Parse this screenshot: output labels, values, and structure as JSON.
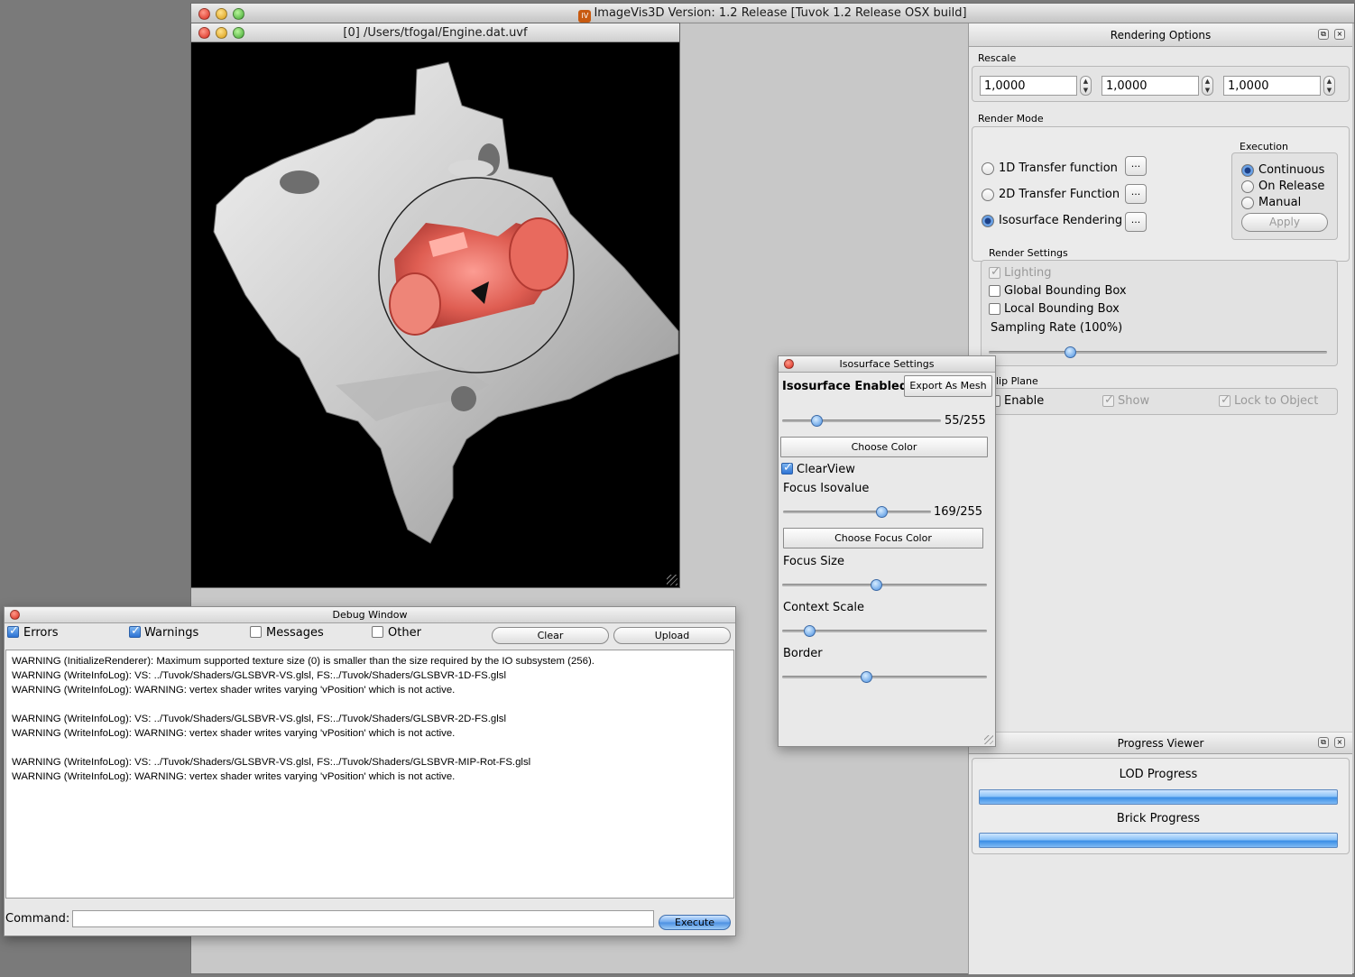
{
  "app": {
    "title": "ImageVis3D Version: 1.2 Release [Tuvok 1.2 Release OSX build]"
  },
  "render_window": {
    "title": "[0] /Users/tfogal/Engine.dat.uvf"
  },
  "rendering_options": {
    "title": "Rendering Options",
    "rescale": {
      "label": "Rescale",
      "values": [
        "1,0000",
        "1,0000",
        "1,0000"
      ]
    },
    "render_mode": {
      "label": "Render Mode",
      "options": [
        "1D Transfer function",
        "2D Transfer Function",
        "Isosurface Rendering"
      ],
      "selected": "Isosurface Rendering",
      "more_button": "..."
    },
    "execution": {
      "label": "Execution",
      "options": [
        "Continuous",
        "On Release",
        "Manual"
      ],
      "selected": "Continuous",
      "apply_label": "Apply"
    },
    "render_settings": {
      "label": "Render Settings",
      "lighting": "Lighting",
      "global_bbox": "Global Bounding Box",
      "local_bbox": "Local Bounding Box",
      "sampling_rate": "Sampling Rate (100%)",
      "sampling_value": 0.24
    },
    "clip_plane": {
      "label": "lip Plane",
      "enable": "Enable",
      "show": "Show",
      "lock": "Lock to Object"
    }
  },
  "isosurface": {
    "title": "Isosurface Settings",
    "enabled_label": "Isosurface Enabled",
    "export_label": "Export As Mesh",
    "iso_readout": "55/255",
    "iso_value": 0.216,
    "choose_color": "Choose Color",
    "clearview": "ClearView",
    "focus_isovalue_label": "Focus Isovalue",
    "focus_readout": "169/255",
    "focus_value": 0.663,
    "choose_focus_color": "Choose Focus Color",
    "focus_size_label": "Focus Size",
    "focus_size_value": 0.46,
    "context_scale_label": "Context Scale",
    "context_scale_value": 0.13,
    "border_label": "Border",
    "border_value": 0.41
  },
  "progress": {
    "title": "Progress Viewer",
    "lod_label": "LOD Progress",
    "brick_label": "Brick Progress"
  },
  "debug": {
    "title": "Debug Window",
    "filters": {
      "errors": "Errors",
      "warnings": "Warnings",
      "messages": "Messages",
      "other": "Other"
    },
    "clear_label": "Clear",
    "upload_label": "Upload",
    "log": [
      "WARNING (InitializeRenderer): Maximum supported texture size (0) is smaller than the size required by the IO subsystem (256).",
      "WARNING (WriteInfoLog): VS: ../Tuvok/Shaders/GLSBVR-VS.glsl, FS:../Tuvok/Shaders/GLSBVR-1D-FS.glsl",
      "WARNING (WriteInfoLog): WARNING: vertex shader writes varying 'vPosition' which is not active.",
      "",
      "WARNING (WriteInfoLog): VS: ../Tuvok/Shaders/GLSBVR-VS.glsl, FS:../Tuvok/Shaders/GLSBVR-2D-FS.glsl",
      "WARNING (WriteInfoLog): WARNING: vertex shader writes varying 'vPosition' which is not active.",
      "",
      "WARNING (WriteInfoLog): VS: ../Tuvok/Shaders/GLSBVR-VS.glsl, FS:../Tuvok/Shaders/GLSBVR-MIP-Rot-FS.glsl",
      "WARNING (WriteInfoLog): WARNING: vertex shader writes varying 'vPosition' which is not active."
    ],
    "command_label": "Command:",
    "command_value": "",
    "execute_label": "Execute"
  }
}
